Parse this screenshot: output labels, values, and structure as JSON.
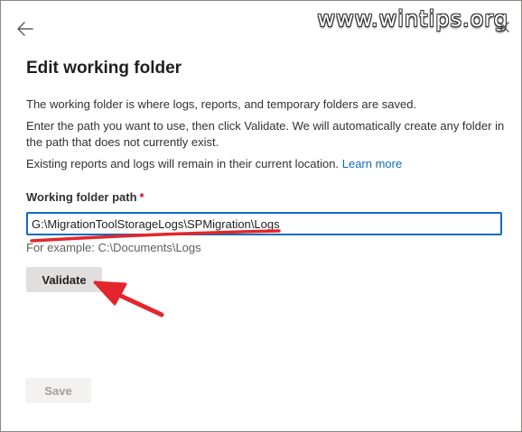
{
  "watermark": "www.wintips.org",
  "header": {
    "back_icon": "arrow-left-icon",
    "close_icon": "close-icon"
  },
  "dialog": {
    "title": "Edit working folder",
    "description_1": "The working folder is where logs, reports, and temporary folders are saved.",
    "description_2": "Enter the path you want to use, then click Validate. We will automatically create any folder in the path that does not currently exist.",
    "description_3": "Existing reports and logs will remain in their current location.",
    "learn_more_link": "Learn more"
  },
  "form": {
    "path_label": "Working folder path",
    "required_marker": "*",
    "path_value": "G:\\MigrationToolStorageLogs\\SPMigration\\Logs",
    "example_text": "For example: C:\\Documents\\Logs",
    "validate_label": "Validate",
    "save_label": "Save"
  },
  "colors": {
    "accent": "#0f6cbd",
    "annotation": "#e3262c"
  }
}
